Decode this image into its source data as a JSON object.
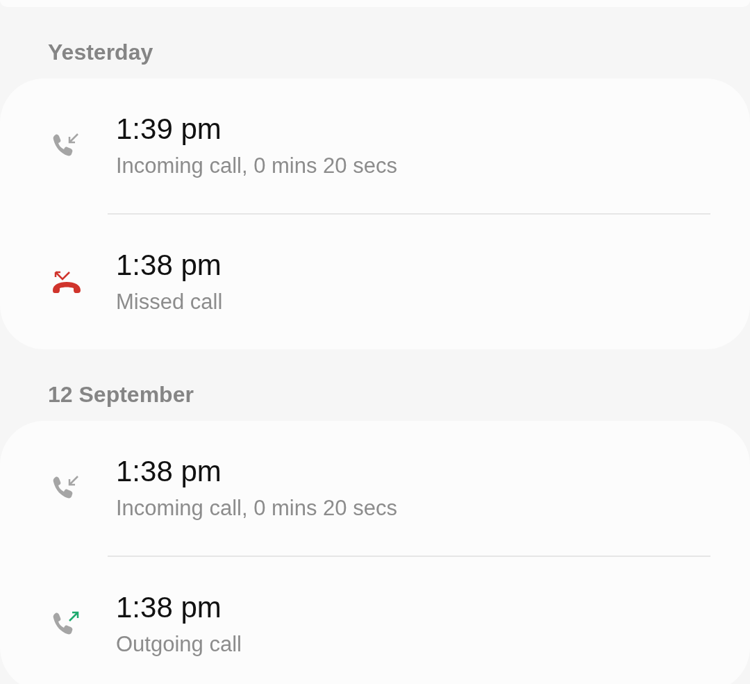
{
  "groups": [
    {
      "heading": "Yesterday",
      "calls": [
        {
          "kind": "incoming",
          "time": "1:39 pm",
          "detail": "Incoming call, 0 mins 20 secs"
        },
        {
          "kind": "missed",
          "time": "1:38 pm",
          "detail": "Missed call"
        }
      ]
    },
    {
      "heading": "12 September",
      "calls": [
        {
          "kind": "incoming",
          "time": "1:38 pm",
          "detail": "Incoming call, 0 mins 20 secs"
        },
        {
          "kind": "outgoing",
          "time": "1:38 pm",
          "detail": "Outgoing call"
        }
      ]
    }
  ]
}
